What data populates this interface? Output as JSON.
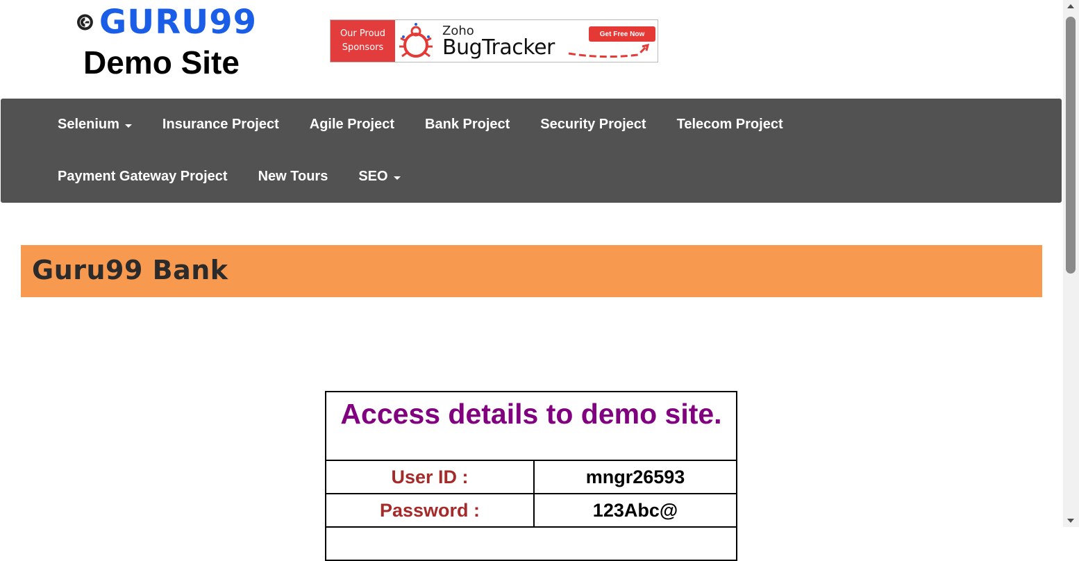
{
  "header": {
    "logo_text": "GURU99",
    "site_title": "Demo Site"
  },
  "sponsor": {
    "line1": "Our Proud",
    "line2": "Sponsors",
    "brand_small": "Zoho",
    "brand_large": "BugTracker",
    "cta": "Get Free Now"
  },
  "nav": {
    "row1": [
      {
        "label": "Selenium",
        "dropdown": true
      },
      {
        "label": "Insurance Project",
        "dropdown": false
      },
      {
        "label": "Agile Project",
        "dropdown": false
      },
      {
        "label": "Bank Project",
        "dropdown": false
      },
      {
        "label": "Security Project",
        "dropdown": false
      },
      {
        "label": "Telecom Project",
        "dropdown": false
      }
    ],
    "row2": [
      {
        "label": "Payment Gateway Project",
        "dropdown": false
      },
      {
        "label": "New Tours",
        "dropdown": false
      },
      {
        "label": "SEO",
        "dropdown": true
      }
    ]
  },
  "bank": {
    "title": "Guru99 Bank"
  },
  "access": {
    "heading": "Access details to demo site.",
    "user_id_label": "User ID :",
    "user_id_value": "mngr26593",
    "password_label": "Password :",
    "password_value": "123Abc@"
  },
  "colors": {
    "navbar_bg": "#525252",
    "bank_banner_bg": "#f79a50",
    "logo_blue": "#1a5ee8",
    "heading_purple": "#800080",
    "label_brown": "#a52a2a",
    "sponsor_red": "#e23c3c"
  },
  "icons": [
    "guru99-logo-icon",
    "bug-icon",
    "caret-down-icon",
    "arrow-icon"
  ]
}
